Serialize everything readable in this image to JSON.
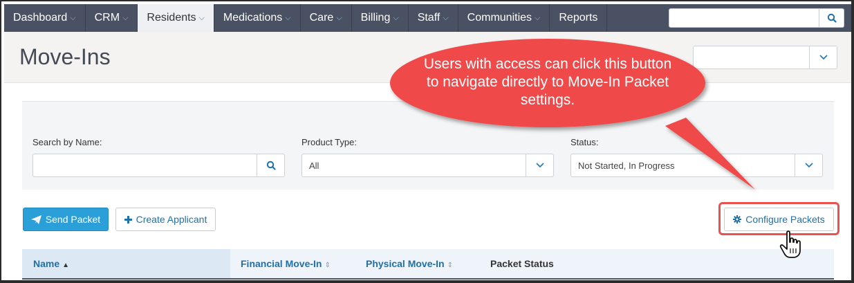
{
  "nav": {
    "items": [
      {
        "label": "Dashboard",
        "has_menu": true,
        "active": false
      },
      {
        "label": "CRM",
        "has_menu": true,
        "active": false
      },
      {
        "label": "Residents",
        "has_menu": true,
        "active": true
      },
      {
        "label": "Medications",
        "has_menu": true,
        "active": false
      },
      {
        "label": "Care",
        "has_menu": true,
        "active": false
      },
      {
        "label": "Billing",
        "has_menu": true,
        "active": false
      },
      {
        "label": "Staff",
        "has_menu": true,
        "active": false
      },
      {
        "label": "Communities",
        "has_menu": true,
        "active": false
      },
      {
        "label": "Reports",
        "has_menu": false,
        "active": false
      }
    ],
    "search": {
      "value": "",
      "placeholder": ""
    },
    "icon": "search-icon",
    "bg_color": "#4a5163"
  },
  "page": {
    "title": "Move-Ins"
  },
  "filters": {
    "name": {
      "label": "Search by Name:",
      "value": ""
    },
    "product_type": {
      "label": "Product Type:",
      "value": "All"
    },
    "status": {
      "label": "Status:",
      "value": "Not Started, In Progress"
    }
  },
  "actions": {
    "send_packet": "Send Packet",
    "create_applicant": "Create Applicant",
    "configure_packets": "Configure Packets",
    "primary_color": "#2a9fd8"
  },
  "table": {
    "columns": [
      {
        "label": "Name",
        "sortable": true,
        "sorted": true
      },
      {
        "label": "Financial Move-In",
        "sortable": true,
        "sorted": false
      },
      {
        "label": "Physical Move-In",
        "sortable": true,
        "sorted": false
      },
      {
        "label": "Packet Status",
        "sortable": false,
        "sorted": false
      }
    ]
  },
  "callout": {
    "text": "Users with access can click this button to navigate directly to Move-In Packet settings.",
    "color": "#f04848"
  }
}
